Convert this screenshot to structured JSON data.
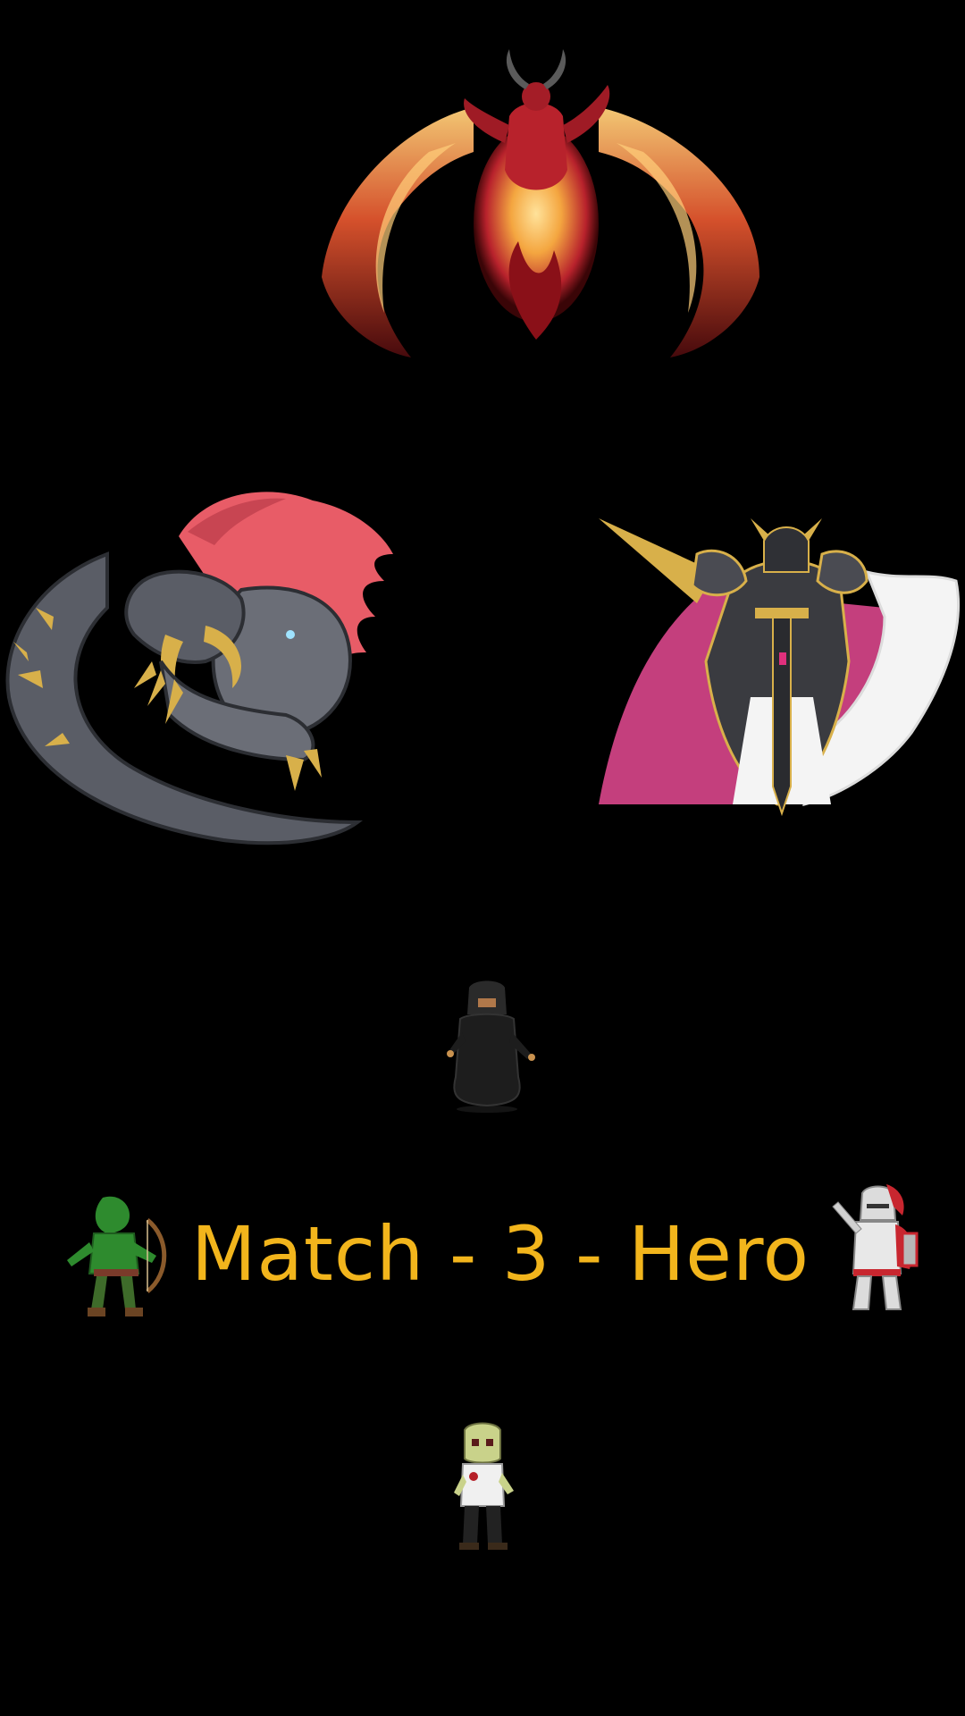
{
  "title": "Match - 3 - Hero",
  "colors": {
    "background": "#000000",
    "title": "#f2b51c",
    "demon_body": "#b8222c",
    "demon_fire": "#f4a640",
    "beast_skin": "#5a5d66",
    "beast_mane": "#e85c67",
    "claws": "#d8b04a",
    "cape": "#c43f7d",
    "armor": "#3a3b40"
  },
  "sprites": [
    {
      "role": "boss-demon",
      "icon": "winged-fire-demon"
    },
    {
      "role": "boss-beast",
      "icon": "red-maned-beast"
    },
    {
      "role": "boss-knight-king",
      "icon": "armored-caped-knight"
    },
    {
      "role": "hero-hooded",
      "icon": "hooded-rogue"
    },
    {
      "role": "hero-archer",
      "icon": "green-archer"
    },
    {
      "role": "hero-paladin",
      "icon": "white-paladin"
    },
    {
      "role": "hero-zombie",
      "icon": "zombie"
    }
  ]
}
